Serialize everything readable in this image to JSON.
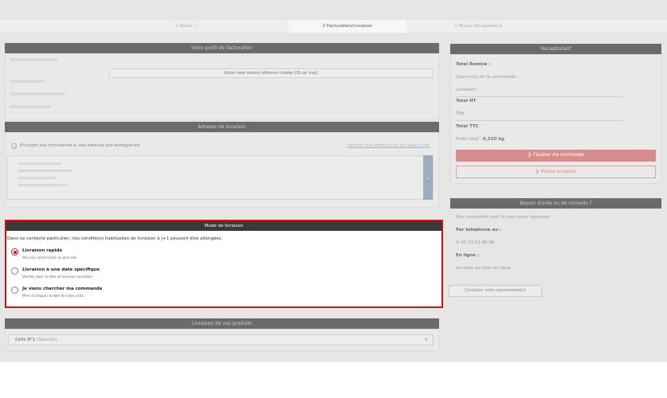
{
  "steps": [
    "1 Panier ✓",
    "2 Facturation/Livraison",
    "3 Moyen de paiement"
  ],
  "billing": {
    "title": "Votre profil de facturation",
    "reference_placeholder": "Entrez votre numéro référence chantier (35 car. max)"
  },
  "address": {
    "title": "Adresse de livraison",
    "option_label": "Envoyer ma commande à une adresse pré-enregistrée",
    "add_link": "Ajouter une adresse ou un relais colis",
    "scroll_icon": "chevron-down-icon"
  },
  "shipping": {
    "title": "Mode de livraison",
    "intro": "Dans ce contexte particulier, nos conditions habituelles de livraison à J+1 peuvent être allongées.",
    "options": [
      {
        "title": "Livraison rapide",
        "desc": "Vos colis seront livrés au plus vite.",
        "selected": true
      },
      {
        "title": "Livraison à une date spécifique",
        "desc": "Veuillez saisir la date de livraison souhaitée.",
        "selected": false
      },
      {
        "title": "Je viens chercher ma commande",
        "desc": "Merci d'indiquer la date de votre visite",
        "selected": false
      }
    ]
  },
  "products": {
    "title": "Livraison de vos produits",
    "colis_label": "Colis N°1",
    "colis_note": "(Sécurisé)",
    "caret": "▾"
  },
  "summary": {
    "title": "Récapitulatif",
    "total_remise": "Total Remise :",
    "sous_total": "Sous-total de la commande :",
    "livraison": "Livraison :",
    "total_ht": "Total HT",
    "tva": "TVA",
    "total_ttc": "Total TTC",
    "poids_label": "Poids total :",
    "poids_value": "0,530 kg",
    "finalize_button": "❯ Finaliser ma commande",
    "back_button": "❯ Retour au panier"
  },
  "help": {
    "title": "Besoin d'aide ou de conseils ?",
    "intro": "Nos conseillers sont là pour vous répondre",
    "phone_label": "Par téléphone au :",
    "phone": "05 53 02 86 86",
    "online_label": "En ligne :",
    "chat_link": "Accéder au chat en ligne",
    "contact_button": "Contacter votre représentant(e)"
  },
  "colors": {
    "overlay": "#e6e6e6",
    "highlight_border": "#cc1111",
    "selected_radio": "#c61a1a",
    "panel_header": "#6b6b6b",
    "finalize_button": "#d78d8d"
  }
}
